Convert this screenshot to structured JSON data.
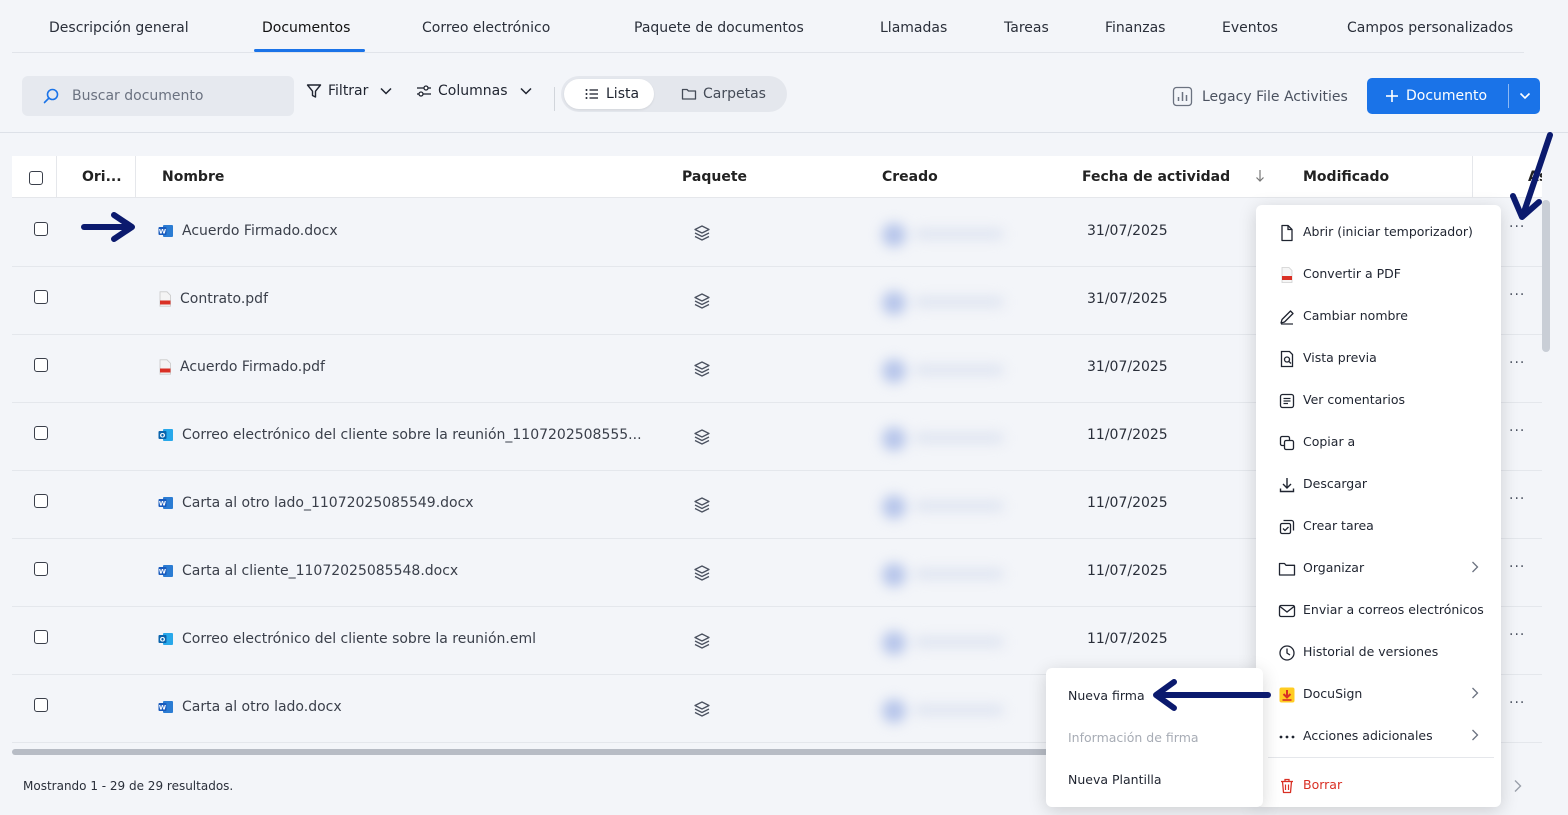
{
  "tabs": [
    {
      "label": "Descripción general"
    },
    {
      "label": "Documentos"
    },
    {
      "label": "Correo electrónico"
    },
    {
      "label": "Paquete de documentos"
    },
    {
      "label": "Llamadas"
    },
    {
      "label": "Tareas"
    },
    {
      "label": "Finanzas"
    },
    {
      "label": "Eventos"
    },
    {
      "label": "Campos personalizados"
    }
  ],
  "active_tab": "Documentos",
  "toolbar": {
    "search_placeholder": "Buscar documento",
    "filter_label": "Filtrar",
    "columns_label": "Columnas",
    "view_list_label": "Lista",
    "view_folders_label": "Carpetas",
    "legacy_label": "Legacy File Activities",
    "new_document_label": "Documento"
  },
  "table": {
    "headers": {
      "origin": "Ori...",
      "name": "Nombre",
      "package": "Paquete",
      "created": "Creado",
      "activity_date": "Fecha de actividad",
      "modified": "Modificado",
      "assigned": "Asig..."
    },
    "rows": [
      {
        "name": "Acuerdo Firmado.docx",
        "icon": "word-icon",
        "date": "31/07/2025"
      },
      {
        "name": "Contrato.pdf",
        "icon": "pdf-icon",
        "date": "31/07/2025"
      },
      {
        "name": "Acuerdo Firmado.pdf",
        "icon": "pdf-icon",
        "date": "31/07/2025"
      },
      {
        "name": "Correo electrónico del cliente sobre la reunión_1107202508555...",
        "icon": "outlook-icon",
        "date": "11/07/2025"
      },
      {
        "name": "Carta al otro lado_11072025085549.docx",
        "icon": "word-icon",
        "date": "11/07/2025"
      },
      {
        "name": "Carta al cliente_11072025085548.docx",
        "icon": "word-icon",
        "date": "11/07/2025"
      },
      {
        "name": "Correo electrónico del cliente sobre la reunión.eml",
        "icon": "outlook-icon",
        "date": "11/07/2025"
      },
      {
        "name": "Carta al otro lado.docx",
        "icon": "word-icon",
        "date": "11/07/2025"
      }
    ]
  },
  "footer": {
    "results_text": "Mostrando 1 - 29 de 29 resultados."
  },
  "context_menu": {
    "items": [
      {
        "label": "Abrir (iniciar temporizador)",
        "icon": "file-icon"
      },
      {
        "label": "Convertir a PDF",
        "icon": "pdf-icon"
      },
      {
        "label": "Cambiar nombre",
        "icon": "pencil-icon"
      },
      {
        "label": "Vista previa",
        "icon": "preview-icon"
      },
      {
        "label": "Ver comentarios",
        "icon": "comments-icon"
      },
      {
        "label": "Copiar a",
        "icon": "copy-icon"
      },
      {
        "label": "Descargar",
        "icon": "download-icon"
      },
      {
        "label": "Crear tarea",
        "icon": "task-icon"
      },
      {
        "label": "Organizar",
        "icon": "folder-icon"
      },
      {
        "label": "Enviar a correos electrónicos",
        "icon": "mail-icon"
      },
      {
        "label": "Historial de versiones",
        "icon": "clock-icon"
      },
      {
        "label": "DocuSign",
        "icon": "docusign-icon"
      },
      {
        "label": "Acciones adicionales",
        "icon": "more-icon"
      },
      {
        "label": "Borrar",
        "icon": "trash-icon"
      }
    ]
  },
  "submenu": {
    "items": [
      {
        "label": "Nueva firma",
        "enabled": true
      },
      {
        "label": "Información de firma",
        "enabled": false
      },
      {
        "label": "Nueva Plantilla",
        "enabled": true
      }
    ]
  },
  "colors": {
    "accent": "#1a73e8",
    "annotation_arrow": "#0b1a6e",
    "danger": "#d93025"
  }
}
